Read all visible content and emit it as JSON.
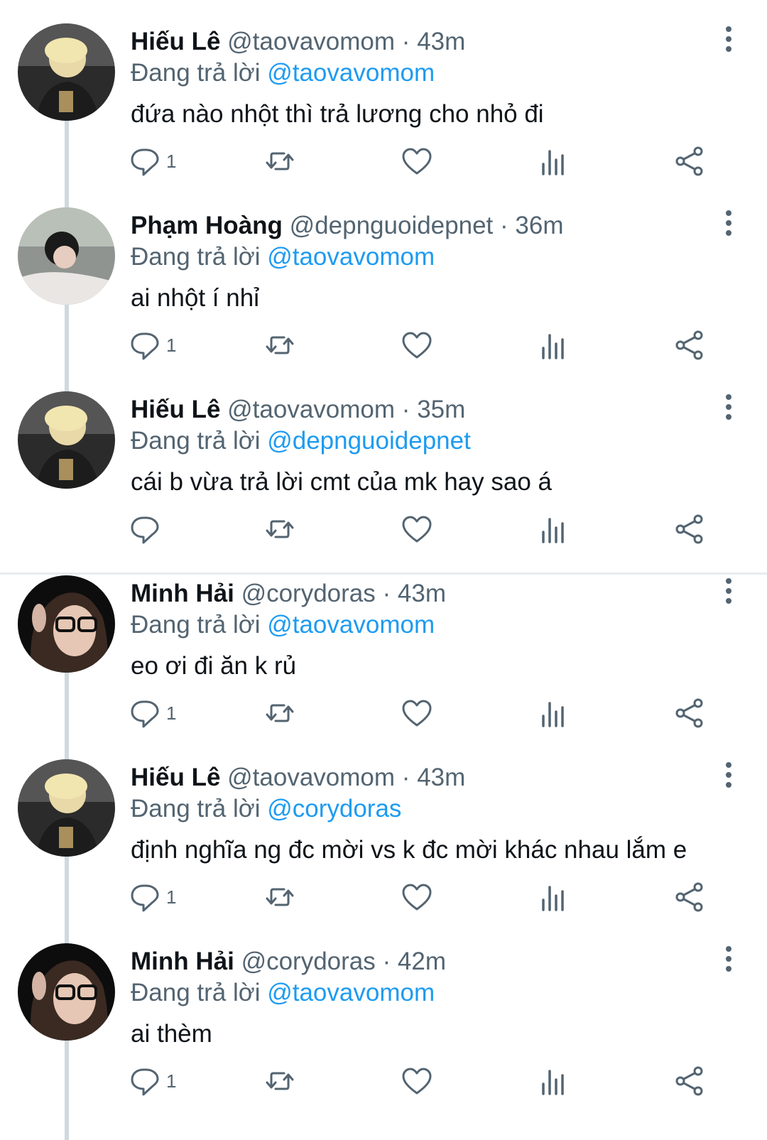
{
  "colors": {
    "accent": "#1d9bf0",
    "text": "#0f1419",
    "muted": "#536471",
    "thread_line": "#cfd9de"
  },
  "icons": [
    "reply-icon",
    "retweet-icon",
    "like-icon",
    "views-icon",
    "share-icon",
    "more-icon"
  ],
  "tweets": [
    {
      "name": "Hiếu Lê",
      "handle": "@taovavomom",
      "sep": "·",
      "time": "43m",
      "reply_prefix": "Đang trả lời",
      "reply_to": "@taovavomom",
      "text": "đứa nào nhột thì trả lương cho nhỏ đi",
      "reply_count": "1"
    },
    {
      "name": "Phạm Hoàng",
      "handle": "@depnguoidepnet",
      "sep": "·",
      "time": "36m",
      "reply_prefix": "Đang trả lời",
      "reply_to": "@taovavomom",
      "text": "ai nhột í nhỉ",
      "reply_count": "1"
    },
    {
      "name": "Hiếu Lê",
      "handle": "@taovavomom",
      "sep": "·",
      "time": "35m",
      "reply_prefix": "Đang trả lời",
      "reply_to": "@depnguoidepnet",
      "text": "cái b vừa trả lời cmt của mk hay sao á",
      "reply_count": ""
    },
    {
      "name": "Minh Hải",
      "handle": "@corydoras",
      "sep": "·",
      "time": "43m",
      "reply_prefix": "Đang trả lời",
      "reply_to": "@taovavomom",
      "text": "eo ơi đi ăn k rủ",
      "reply_count": "1"
    },
    {
      "name": "Hiếu Lê",
      "handle": "@taovavomom",
      "sep": "·",
      "time": "43m",
      "reply_prefix": "Đang trả lời",
      "reply_to": "@corydoras",
      "text": "định nghĩa ng đc mời vs k đc mời khác nhau lắm e",
      "reply_count": "1"
    },
    {
      "name": "Minh Hải",
      "handle": "@corydoras",
      "sep": "·",
      "time": "42m",
      "reply_prefix": "Đang trả lời",
      "reply_to": "@taovavomom",
      "text": "ai thèm",
      "reply_count": "1"
    }
  ]
}
